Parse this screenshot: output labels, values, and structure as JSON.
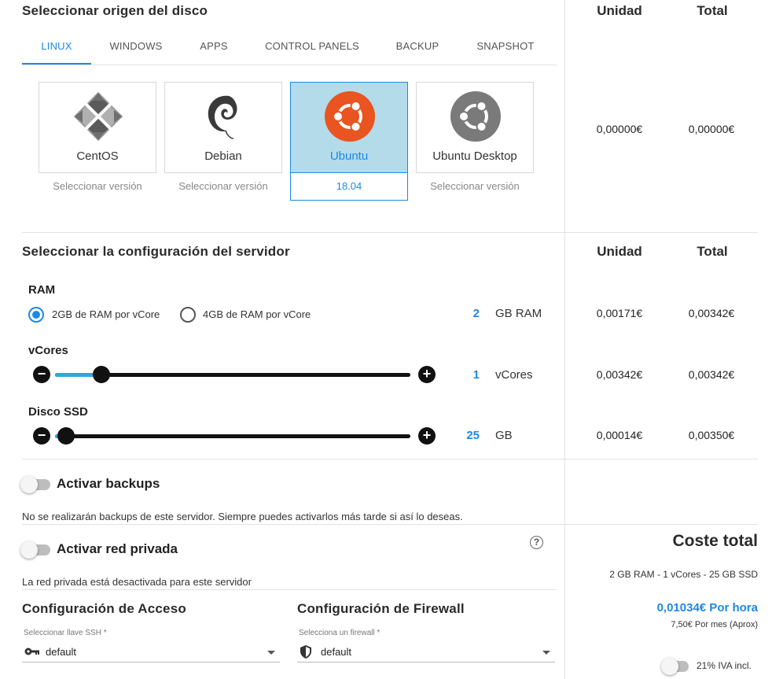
{
  "disk": {
    "title": "Seleccionar origen del disco",
    "tabs": [
      "LINUX",
      "WINDOWS",
      "APPS",
      "CONTROL PANELS",
      "BACKUP",
      "SNAPSHOT"
    ],
    "active_tab": "LINUX",
    "images": [
      {
        "name": "CentOS",
        "version": "Seleccionar versión",
        "icon": "centos-logo-icon"
      },
      {
        "name": "Debian",
        "version": "Seleccionar versión",
        "icon": "debian-logo-icon"
      },
      {
        "name": "Ubuntu",
        "version": "18.04",
        "icon": "ubuntu-logo-icon",
        "selected": true
      },
      {
        "name": "Ubuntu Desktop",
        "version": "Seleccionar versión",
        "icon": "ubuntu-desktop-logo-icon"
      }
    ],
    "unit_header": "Unidad",
    "total_header": "Total",
    "unit_price": "0,00000€",
    "total_price": "0,00000€"
  },
  "server": {
    "title": "Seleccionar la configuración del servidor",
    "unit_header": "Unidad",
    "total_header": "Total",
    "ram": {
      "label": "RAM",
      "option1": "2GB de RAM por vCore",
      "option2": "4GB de RAM por vCore",
      "selected_option": 1,
      "value": "2",
      "unit": "GB RAM",
      "unit_price": "0,00171€",
      "total_price": "0,00342€"
    },
    "vcores": {
      "label": "vCores",
      "value": "1",
      "unit": "vCores",
      "slider_fraction": 0.13,
      "unit_price": "0,00342€",
      "total_price": "0,00342€"
    },
    "ssd": {
      "label": "Disco SSD",
      "value": "25",
      "unit": "GB",
      "slider_fraction": 0.03,
      "unit_price": "0,00014€",
      "total_price": "0,00350€"
    }
  },
  "backups": {
    "label": "Activar backups",
    "enabled": false,
    "note": "No se realizarán backups de este servidor. Siempre puedes activarlos más tarde si así lo deseas."
  },
  "private_network": {
    "label": "Activar red privada",
    "enabled": false,
    "note": "La red privada está desactivada para este servidor"
  },
  "access": {
    "title": "Configuración de Acceso",
    "field_label": "Seleccionar llave SSH *",
    "value": "default"
  },
  "firewall": {
    "title": "Configuración de Firewall",
    "field_label": "Selecciona un firewall *",
    "value": "default"
  },
  "summary": {
    "title": "Coste total",
    "specs": "2 GB RAM - 1 vCores - 25 GB SSD",
    "hourly": "0,01034€ Por hora",
    "monthly": "7,50€ Por mes (Aprox)",
    "vat_label": "21% IVA incl.",
    "vat_enabled": false
  },
  "colors": {
    "accent": "#1e88e5",
    "selected_card_bg": "#b3dbea",
    "slider_fill": "#29a8e0",
    "ubuntu_orange": "#e95420",
    "ubuntu_desktop_gray": "#7a7a7a"
  }
}
